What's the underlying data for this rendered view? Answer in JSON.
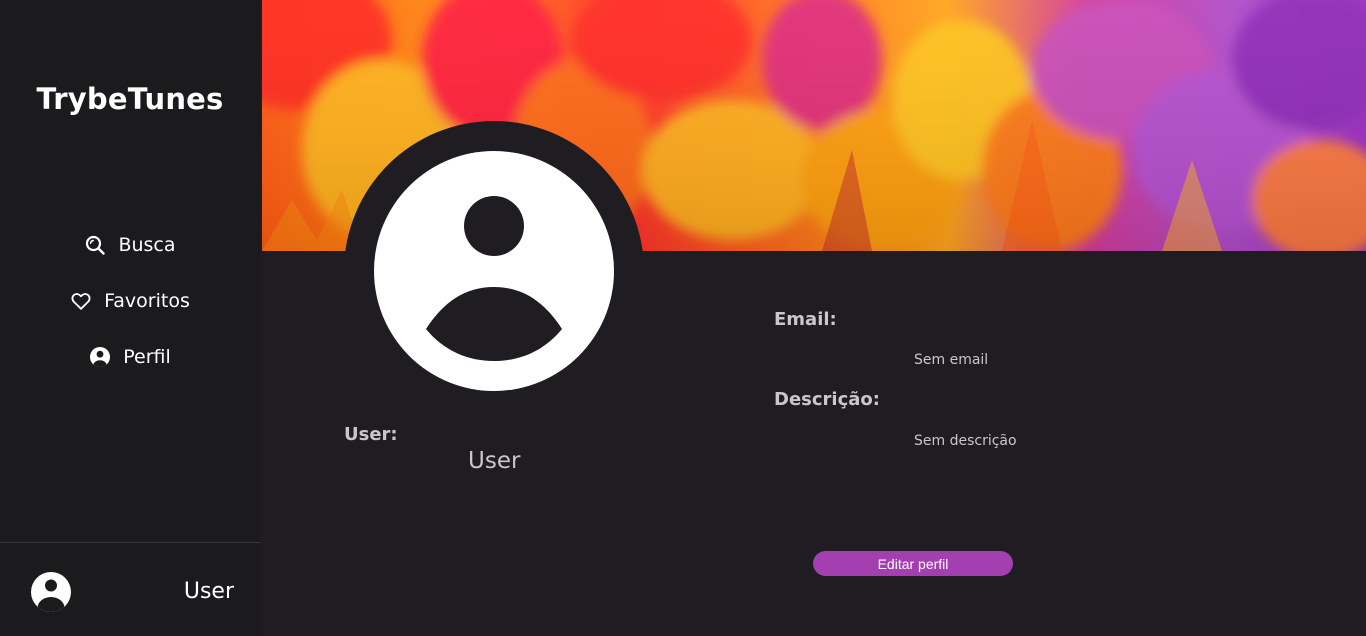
{
  "app": {
    "title": "TrybeTunes"
  },
  "sidebar": {
    "items": [
      {
        "label": "Busca",
        "icon": "search-icon"
      },
      {
        "label": "Favoritos",
        "icon": "heart-icon"
      },
      {
        "label": "Perfil",
        "icon": "user-circle-icon"
      }
    ],
    "user": {
      "name": "User",
      "icon": "user-avatar-icon"
    }
  },
  "profile": {
    "user_label": "User:",
    "user_value": "User",
    "email_label": "Email:",
    "email_value": "Sem email",
    "description_label": "Descrição:",
    "description_value": "Sem descrição",
    "edit_button": "Editar perfil"
  },
  "colors": {
    "background": "#1f1d22",
    "sidebar": "#1b1a1d",
    "accent": "#a33fb1",
    "text": "#c9c7cc"
  }
}
